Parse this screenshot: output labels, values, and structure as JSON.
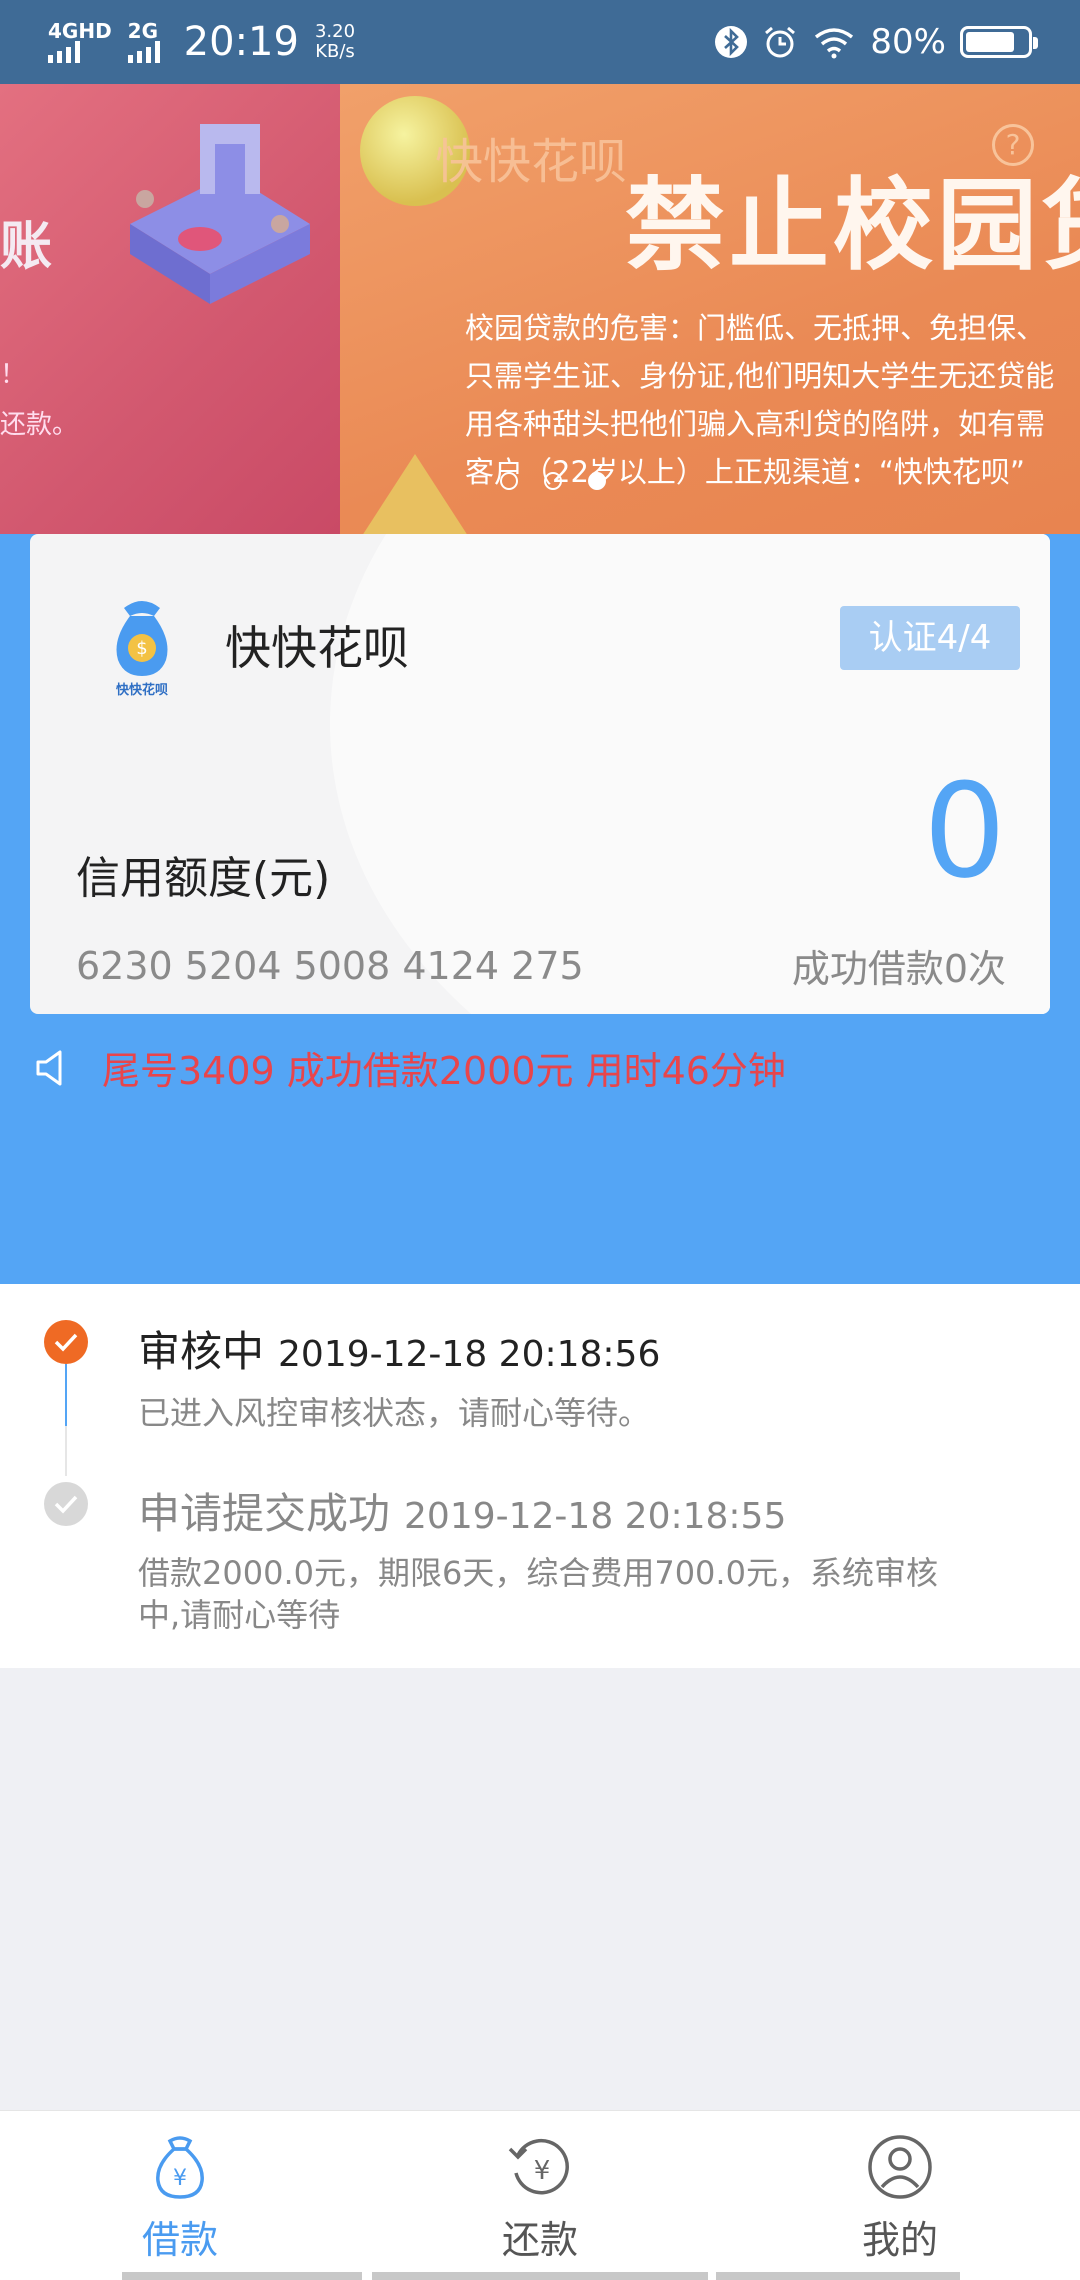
{
  "status_bar": {
    "network_1": "4GHD",
    "network_2": "2G",
    "time": "20:19",
    "speed_value": "3.20",
    "speed_unit": "KB/s",
    "battery_percent": "80%",
    "battery_level": 0.8
  },
  "banner": {
    "left_title": "账",
    "left_line_1": "！",
    "left_line_2": "还款。",
    "brand": "快快花呗",
    "title": "禁止校园贷",
    "lines": [
      "校园贷款的危害：门槛低、无抵押、免担保、",
      "只需学生证、身份证,他们明知大学生无还贷能",
      "用各种甜头把他们骗入高利贷的陷阱，如有需",
      "客户（22岁以上）上正规渠道：“快快花呗”"
    ],
    "slide_count": 3,
    "active_slide": 2
  },
  "card": {
    "app_name": "快快花呗",
    "logo_caption": "快快花呗",
    "auth_label": "认证4/4",
    "credit_value": "0",
    "limit_label": "信用额度(元)",
    "card_number": "6230 5204 5008 4124 275",
    "success_count": "成功借款0次"
  },
  "notice": {
    "text": "尾号3409 成功借款2000元 用时46分钟"
  },
  "timeline": [
    {
      "title": "审核中",
      "date": "2019-12-18 20:18:56",
      "desc": "已进入风控审核状态，请耐心等待。"
    },
    {
      "title": "申请提交成功",
      "date": "2019-12-18 20:18:55",
      "desc_line_1": "借款2000.0元，期限6天，综合费用700.0元，系统审核",
      "desc_line_2": "中,请耐心等待"
    }
  ],
  "nav": {
    "items": [
      {
        "label": "借款",
        "icon": "money-bag-icon"
      },
      {
        "label": "还款",
        "icon": "repay-yen-icon"
      },
      {
        "label": "我的",
        "icon": "user-icon"
      }
    ],
    "active": "借款",
    "active_color": "#4a9bf0"
  },
  "colors": {
    "status_bar": "#3f6b96",
    "primary_blue": "#54a5f5",
    "notice_red": "#e8454b",
    "timeline_active": "#ef6a24"
  }
}
